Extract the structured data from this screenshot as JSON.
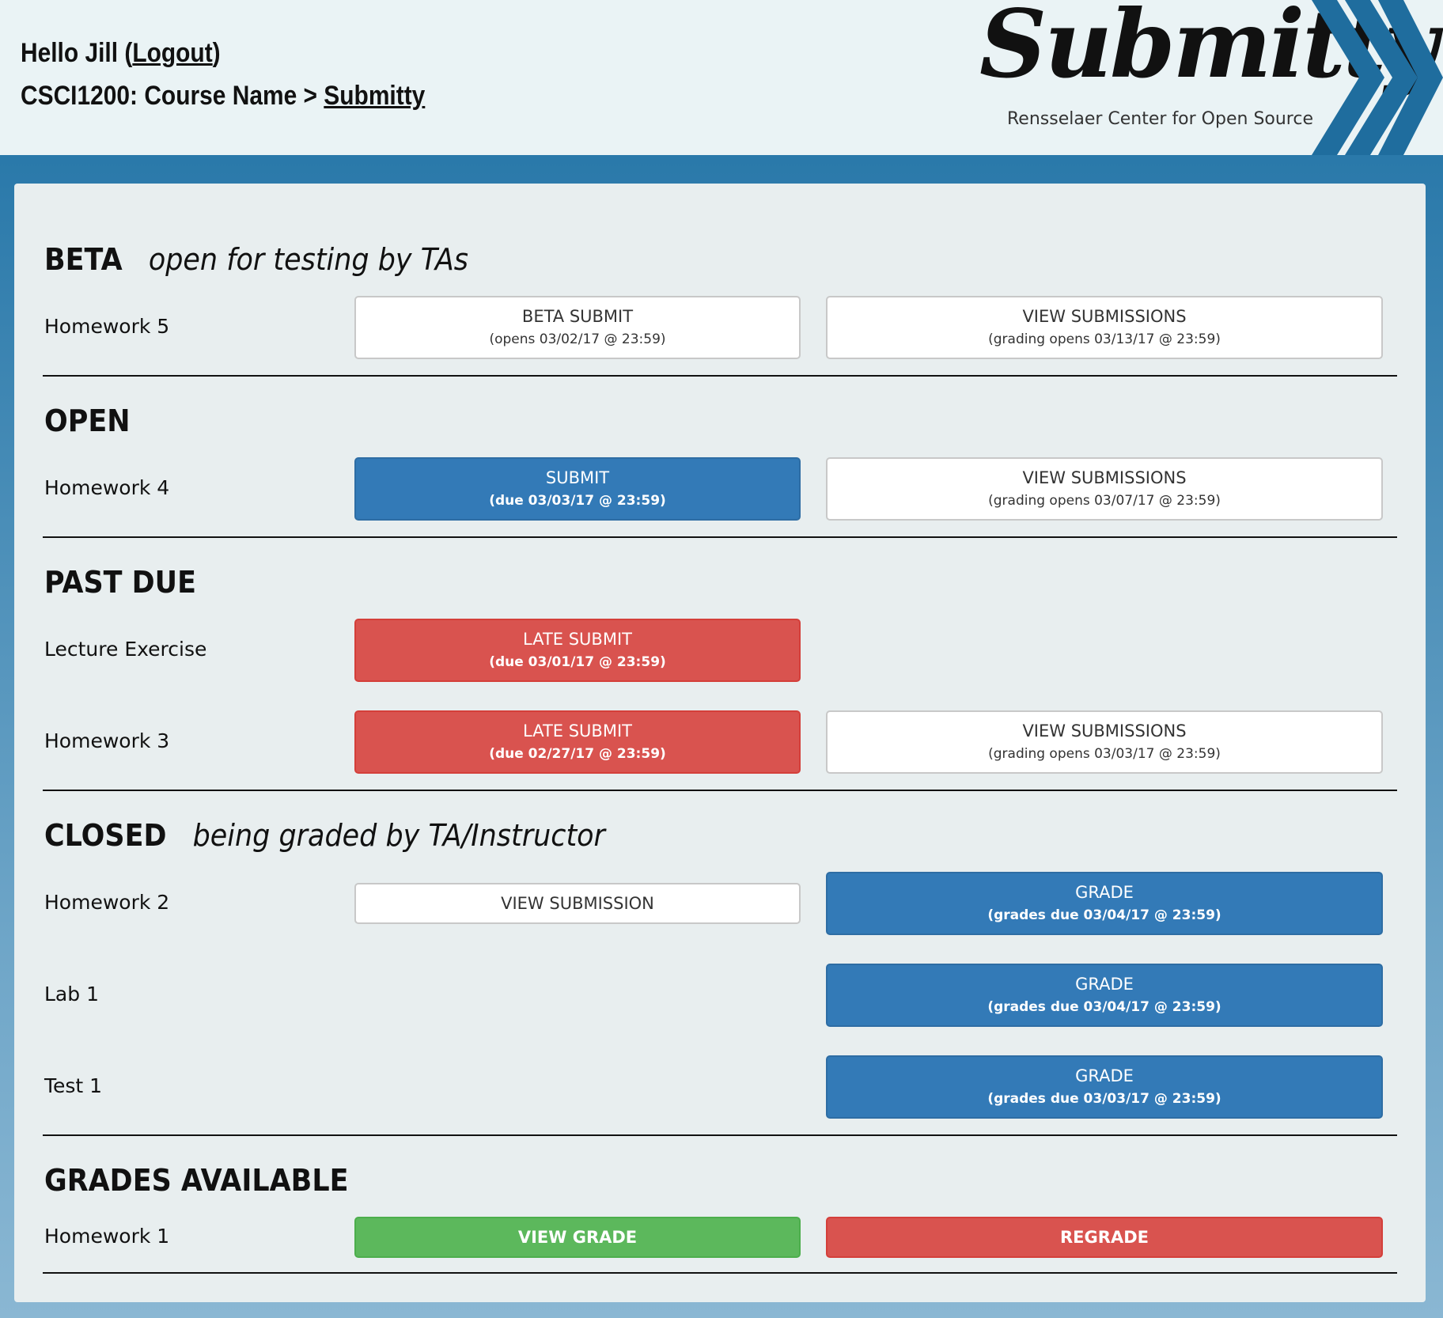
{
  "header": {
    "greeting": "Hello Jill (",
    "logout_label": "Logout",
    "greeting_end": ")",
    "course": "CSCI1200: Course Name > ",
    "breadcrumb_link": "Submitty",
    "logo_wordmark": "Submitty",
    "logo_tagline": "Rensselaer Center for Open Source"
  },
  "sections": {
    "beta": {
      "title": "BETA",
      "subtitle": "open for testing by TAs",
      "rows": [
        {
          "label": "Homework 5",
          "primary": {
            "main": "BETA SUBMIT",
            "sub": "(opens 03/02/17 @ 23:59)"
          },
          "secondary": {
            "main": "VIEW SUBMISSIONS",
            "sub": "(grading opens 03/13/17 @ 23:59)"
          }
        }
      ]
    },
    "open": {
      "title": "OPEN",
      "rows": [
        {
          "label": "Homework 4",
          "primary": {
            "main": "SUBMIT",
            "sub": "(due 03/03/17 @ 23:59)"
          },
          "secondary": {
            "main": "VIEW SUBMISSIONS",
            "sub": "(grading opens 03/07/17 @ 23:59)"
          }
        }
      ]
    },
    "past_due": {
      "title": "PAST DUE",
      "rows": [
        {
          "label": "Lecture Exercise",
          "primary": {
            "main": "LATE SUBMIT",
            "sub": "(due 03/01/17 @ 23:59)"
          }
        },
        {
          "label": "Homework 3",
          "primary": {
            "main": "LATE SUBMIT",
            "sub": "(due 02/27/17 @ 23:59)"
          },
          "secondary": {
            "main": "VIEW SUBMISSIONS",
            "sub": "(grading opens 03/03/17 @ 23:59)"
          }
        }
      ]
    },
    "closed": {
      "title": "CLOSED",
      "subtitle": "being graded by TA/Instructor",
      "rows": [
        {
          "label": "Homework 2",
          "primary": {
            "main": "VIEW SUBMISSION"
          },
          "secondary": {
            "main": "GRADE",
            "sub": "(grades due 03/04/17 @ 23:59)"
          }
        },
        {
          "label": "Lab 1",
          "secondary": {
            "main": "GRADE",
            "sub": "(grades due 03/04/17 @ 23:59)"
          }
        },
        {
          "label": "Test 1",
          "secondary": {
            "main": "GRADE",
            "sub": "(grades due 03/03/17 @ 23:59)"
          }
        }
      ]
    },
    "grades_available": {
      "title": "GRADES AVAILABLE",
      "rows": [
        {
          "label": "Homework 1",
          "primary": {
            "main": "VIEW GRADE"
          },
          "secondary": {
            "main": "REGRADE"
          }
        }
      ]
    }
  },
  "colors": {
    "blue": "#337ab7",
    "red": "#d9534f",
    "green": "#5cb85c",
    "logo_chevron": "#1f6d9e"
  }
}
